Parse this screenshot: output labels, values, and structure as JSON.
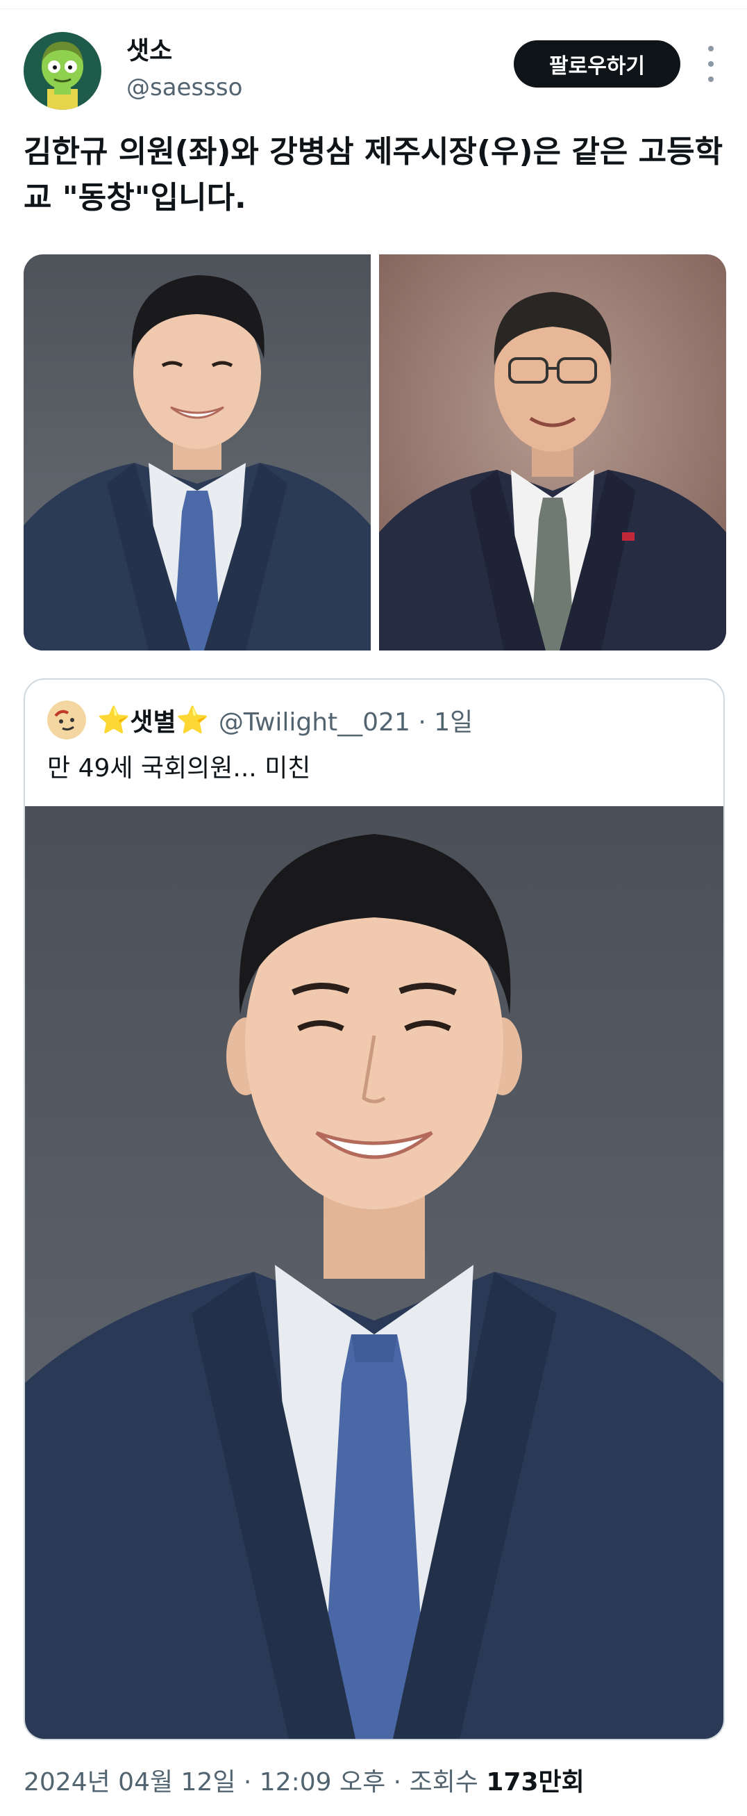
{
  "author": {
    "display_name": "샛소",
    "handle": "@saessso",
    "avatar_icon": "zombie-cartoon-avatar"
  },
  "actions": {
    "follow_label": "팔로우하기",
    "more_icon": "more-vertical-icon"
  },
  "tweet": {
    "text": "김한규 의원(좌)와 강병삼 제주시장(우)은 같은 고등학교 \"동창\"입니다."
  },
  "quote": {
    "star_left": "⭐",
    "name": "샛별",
    "star_right": "⭐",
    "handle_time": "@Twilight__021 · 1일",
    "text": "만 49세 국회의원... 미친"
  },
  "meta": {
    "timestamp": "2024년 04월 12일 · 12:09 오후 · 조회수 ",
    "views": "173만회"
  },
  "colors": {
    "text_primary": "#0f1419",
    "text_secondary": "#536471",
    "follow_bg": "#0f1419",
    "border": "#cfd9de",
    "photo_bg_left": "#5a5f66",
    "photo_bg_right": "#8a6a62"
  }
}
